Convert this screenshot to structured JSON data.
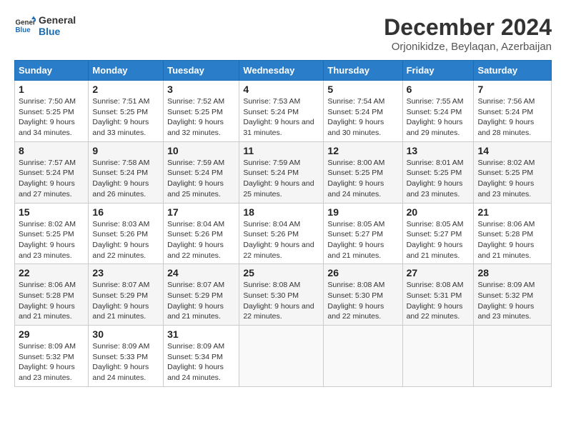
{
  "logo": {
    "line1": "General",
    "line2": "Blue"
  },
  "title": "December 2024",
  "subtitle": "Orjonikidze, Beylaqan, Azerbaijan",
  "days_of_week": [
    "Sunday",
    "Monday",
    "Tuesday",
    "Wednesday",
    "Thursday",
    "Friday",
    "Saturday"
  ],
  "weeks": [
    [
      {
        "day": "1",
        "sunrise": "7:50 AM",
        "sunset": "5:25 PM",
        "daylight": "9 hours and 34 minutes."
      },
      {
        "day": "2",
        "sunrise": "7:51 AM",
        "sunset": "5:25 PM",
        "daylight": "9 hours and 33 minutes."
      },
      {
        "day": "3",
        "sunrise": "7:52 AM",
        "sunset": "5:25 PM",
        "daylight": "9 hours and 32 minutes."
      },
      {
        "day": "4",
        "sunrise": "7:53 AM",
        "sunset": "5:24 PM",
        "daylight": "9 hours and 31 minutes."
      },
      {
        "day": "5",
        "sunrise": "7:54 AM",
        "sunset": "5:24 PM",
        "daylight": "9 hours and 30 minutes."
      },
      {
        "day": "6",
        "sunrise": "7:55 AM",
        "sunset": "5:24 PM",
        "daylight": "9 hours and 29 minutes."
      },
      {
        "day": "7",
        "sunrise": "7:56 AM",
        "sunset": "5:24 PM",
        "daylight": "9 hours and 28 minutes."
      }
    ],
    [
      {
        "day": "8",
        "sunrise": "7:57 AM",
        "sunset": "5:24 PM",
        "daylight": "9 hours and 27 minutes."
      },
      {
        "day": "9",
        "sunrise": "7:58 AM",
        "sunset": "5:24 PM",
        "daylight": "9 hours and 26 minutes."
      },
      {
        "day": "10",
        "sunrise": "7:59 AM",
        "sunset": "5:24 PM",
        "daylight": "9 hours and 25 minutes."
      },
      {
        "day": "11",
        "sunrise": "7:59 AM",
        "sunset": "5:24 PM",
        "daylight": "9 hours and 25 minutes."
      },
      {
        "day": "12",
        "sunrise": "8:00 AM",
        "sunset": "5:25 PM",
        "daylight": "9 hours and 24 minutes."
      },
      {
        "day": "13",
        "sunrise": "8:01 AM",
        "sunset": "5:25 PM",
        "daylight": "9 hours and 23 minutes."
      },
      {
        "day": "14",
        "sunrise": "8:02 AM",
        "sunset": "5:25 PM",
        "daylight": "9 hours and 23 minutes."
      }
    ],
    [
      {
        "day": "15",
        "sunrise": "8:02 AM",
        "sunset": "5:25 PM",
        "daylight": "9 hours and 23 minutes."
      },
      {
        "day": "16",
        "sunrise": "8:03 AM",
        "sunset": "5:26 PM",
        "daylight": "9 hours and 22 minutes."
      },
      {
        "day": "17",
        "sunrise": "8:04 AM",
        "sunset": "5:26 PM",
        "daylight": "9 hours and 22 minutes."
      },
      {
        "day": "18",
        "sunrise": "8:04 AM",
        "sunset": "5:26 PM",
        "daylight": "9 hours and 22 minutes."
      },
      {
        "day": "19",
        "sunrise": "8:05 AM",
        "sunset": "5:27 PM",
        "daylight": "9 hours and 21 minutes."
      },
      {
        "day": "20",
        "sunrise": "8:05 AM",
        "sunset": "5:27 PM",
        "daylight": "9 hours and 21 minutes."
      },
      {
        "day": "21",
        "sunrise": "8:06 AM",
        "sunset": "5:28 PM",
        "daylight": "9 hours and 21 minutes."
      }
    ],
    [
      {
        "day": "22",
        "sunrise": "8:06 AM",
        "sunset": "5:28 PM",
        "daylight": "9 hours and 21 minutes."
      },
      {
        "day": "23",
        "sunrise": "8:07 AM",
        "sunset": "5:29 PM",
        "daylight": "9 hours and 21 minutes."
      },
      {
        "day": "24",
        "sunrise": "8:07 AM",
        "sunset": "5:29 PM",
        "daylight": "9 hours and 21 minutes."
      },
      {
        "day": "25",
        "sunrise": "8:08 AM",
        "sunset": "5:30 PM",
        "daylight": "9 hours and 22 minutes."
      },
      {
        "day": "26",
        "sunrise": "8:08 AM",
        "sunset": "5:30 PM",
        "daylight": "9 hours and 22 minutes."
      },
      {
        "day": "27",
        "sunrise": "8:08 AM",
        "sunset": "5:31 PM",
        "daylight": "9 hours and 22 minutes."
      },
      {
        "day": "28",
        "sunrise": "8:09 AM",
        "sunset": "5:32 PM",
        "daylight": "9 hours and 23 minutes."
      }
    ],
    [
      {
        "day": "29",
        "sunrise": "8:09 AM",
        "sunset": "5:32 PM",
        "daylight": "9 hours and 23 minutes."
      },
      {
        "day": "30",
        "sunrise": "8:09 AM",
        "sunset": "5:33 PM",
        "daylight": "9 hours and 24 minutes."
      },
      {
        "day": "31",
        "sunrise": "8:09 AM",
        "sunset": "5:34 PM",
        "daylight": "9 hours and 24 minutes."
      },
      null,
      null,
      null,
      null
    ]
  ]
}
